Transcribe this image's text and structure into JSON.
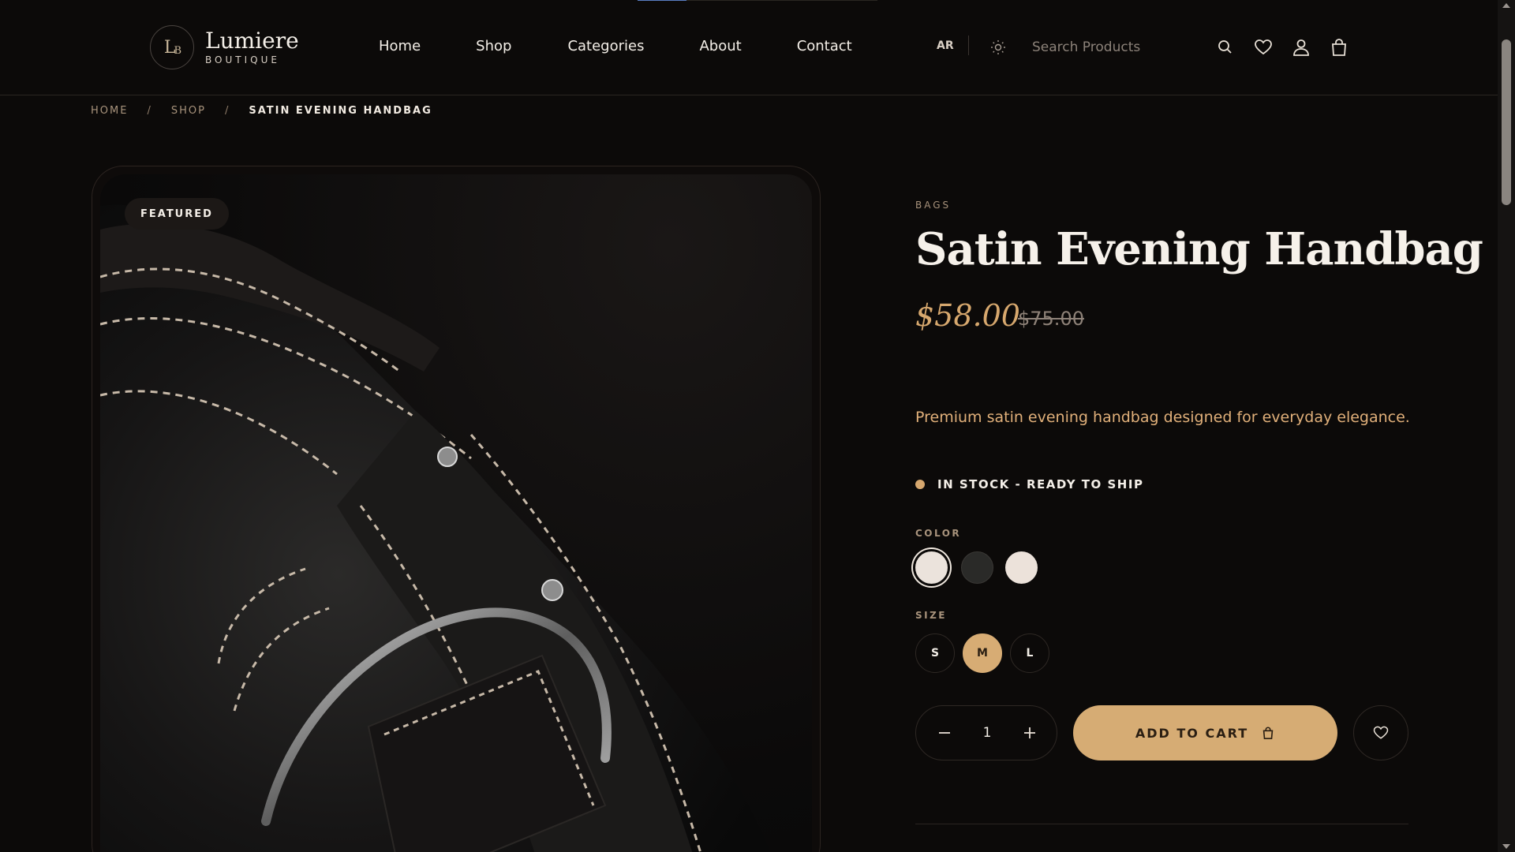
{
  "brand": {
    "initials_main": "L",
    "initials_sub": "B",
    "name": "Lumiere",
    "tagline": "BOUTIQUE"
  },
  "nav": {
    "items": [
      "Home",
      "Shop",
      "Categories",
      "About",
      "Contact"
    ]
  },
  "header": {
    "language": "AR",
    "search_placeholder": "Search Products",
    "icons": [
      "theme-icon",
      "search-icon",
      "heart-icon",
      "user-icon",
      "bag-icon"
    ]
  },
  "breadcrumb": {
    "items": [
      "HOME",
      "SHOP",
      "SATIN EVENING HANDBAG"
    ],
    "separator": "/"
  },
  "product": {
    "badge": "FEATURED",
    "category": "BAGS",
    "title": "Satin Evening Handbag",
    "price": "$58.00",
    "old_price": "$75.00",
    "description": "Premium satin evening handbag designed for everyday elegance.",
    "stock": "IN STOCK - READY TO SHIP",
    "color_label": "COLOR",
    "colors": [
      {
        "name": "ivory",
        "hex": "#ebe3dc",
        "selected": true
      },
      {
        "name": "charcoal",
        "hex": "#2a2a28",
        "selected": false
      },
      {
        "name": "cream",
        "hex": "#ece2da",
        "selected": false
      }
    ],
    "size_label": "SIZE",
    "sizes": [
      {
        "label": "S",
        "active": false
      },
      {
        "label": "M",
        "active": true
      },
      {
        "label": "L",
        "active": false
      }
    ],
    "quantity": "1",
    "add_to_cart": "ADD TO CART"
  },
  "colors": {
    "accent": "#d6ac74",
    "price": "#d7a86e",
    "background": "#0c0a09",
    "muted": "#a8937c"
  }
}
